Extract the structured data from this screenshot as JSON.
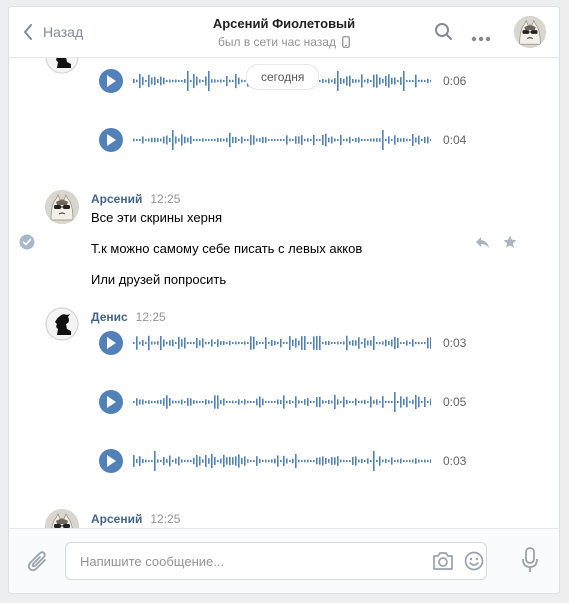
{
  "header": {
    "back_label": "Назад",
    "contact_name": "Арсений Фиолетовый",
    "status": "был в сети час назад"
  },
  "feed": {
    "date_divider": "сегодня",
    "voice_top": [
      {
        "duration": "0:06"
      },
      {
        "duration": "0:04"
      }
    ],
    "group_arseny": {
      "name": "Арсений",
      "time": "12:25",
      "messages": [
        "Все эти скрины херня",
        "Т.к можно самому себе писать с левых акков",
        "Или друзей попросить"
      ]
    },
    "group_denis": {
      "name": "Денис",
      "time": "12:25",
      "voice": [
        {
          "duration": "0:03"
        },
        {
          "duration": "0:05"
        },
        {
          "duration": "0:03"
        }
      ]
    },
    "group_arseny_2": {
      "name": "Арсений",
      "time": "12:25"
    }
  },
  "composer": {
    "placeholder": "Напишите сообщение..."
  },
  "colors": {
    "accent": "#5181b8",
    "name": "#42648b",
    "muted": "#939393"
  }
}
